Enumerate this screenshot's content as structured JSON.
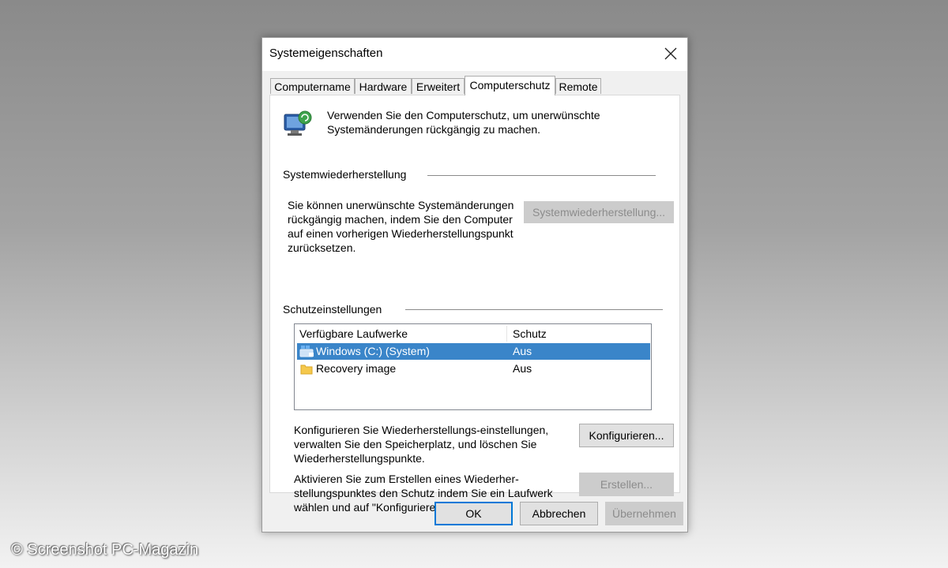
{
  "window": {
    "title": "Systemeigenschaften"
  },
  "tabs": [
    {
      "label": "Computername"
    },
    {
      "label": "Hardware"
    },
    {
      "label": "Erweitert"
    },
    {
      "label": "Computerschutz",
      "active": true
    },
    {
      "label": "Remote"
    }
  ],
  "intro_text": "Verwenden Sie den Computerschutz, um unerwünschte Systemänderungen rückgängig zu machen.",
  "restore": {
    "section_title": "Systemwiederherstellung",
    "description": "Sie können unerwünschte Systemänderungen rückgängig machen, indem Sie den Computer auf einen vorherigen Wiederherstellungspunkt zurücksetzen.",
    "button_label": "Systemwiederherstellung..."
  },
  "protection": {
    "section_title": "Schutzeinstellungen",
    "columns": [
      "Verfügbare Laufwerke",
      "Schutz"
    ],
    "drives": [
      {
        "name": "Windows (C:) (System)",
        "status": "Aus",
        "icon": "system-drive-icon",
        "selected": true
      },
      {
        "name": "Recovery image",
        "status": "Aus",
        "icon": "folder-drive-icon",
        "selected": false
      }
    ],
    "configure_text": "Konfigurieren Sie Wiederherstellungs-einstellungen, verwalten Sie den Speicherplatz, und löschen Sie Wiederherstellungspunkte.",
    "configure_button": "Konfigurieren...",
    "create_text": "Aktivieren Sie zum Erstellen eines Wiederher-stellungspunktes den Schutz indem Sie ein Laufwerk wählen und auf \"Konfigurieren\" klicken.",
    "create_button": "Erstellen..."
  },
  "footer": {
    "ok": "OK",
    "cancel": "Abbrechen",
    "apply": "Übernehmen"
  },
  "watermark": "© Screenshot PC-Magazin",
  "colors": {
    "selection": "#3a85c9",
    "default_button_border": "#0078d7"
  }
}
